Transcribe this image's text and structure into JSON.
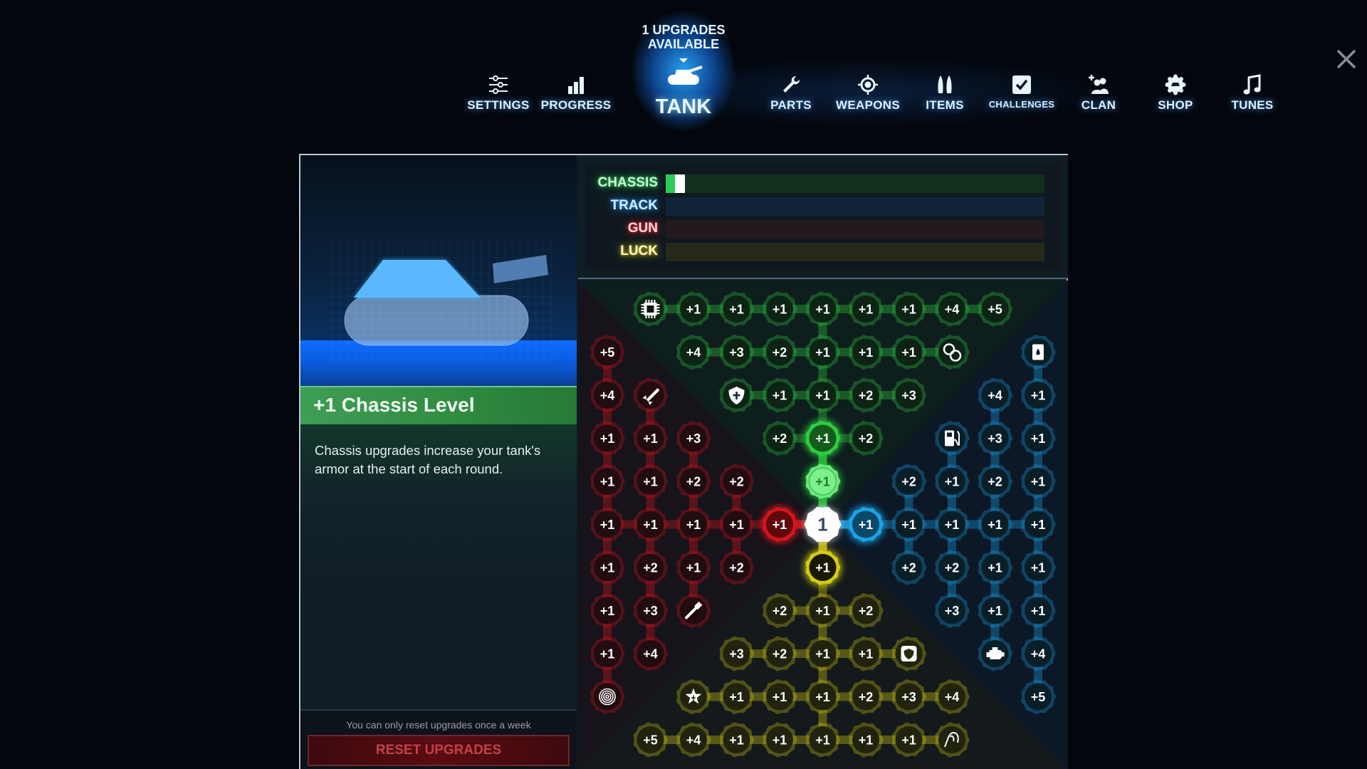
{
  "nav": {
    "items": [
      {
        "key": "settings",
        "label": "SETTINGS",
        "icon": "sliders-icon"
      },
      {
        "key": "progress",
        "label": "PROGRESS",
        "icon": "bar-chart-icon"
      },
      {
        "key": "parts",
        "label": "PARTS",
        "icon": "wrench-icon"
      },
      {
        "key": "weapons",
        "label": "WEAPONS",
        "icon": "crosshair-icon"
      },
      {
        "key": "items",
        "label": "ITEMS",
        "icon": "shells-icon"
      },
      {
        "key": "challenges",
        "label": "CHALLENGES",
        "icon": "checkbox-icon"
      },
      {
        "key": "clan",
        "label": "CLAN",
        "icon": "add-user-icon"
      },
      {
        "key": "shop",
        "label": "SHOP",
        "icon": "shop-badge-icon"
      },
      {
        "key": "tunes",
        "label": "TUNES",
        "icon": "music-note-icon"
      }
    ],
    "active": {
      "label": "TANK",
      "badge_line1": "1 UPGRADES",
      "badge_line2": "AVAILABLE",
      "icon": "tank-icon"
    },
    "close_icon": "close-icon"
  },
  "selected_upgrade": {
    "title": "+1 Chassis Level",
    "description": "Chassis upgrades increase your tank's armor at the start of each round."
  },
  "reset": {
    "note": "You can only reset upgrades once a week",
    "button_label": "RESET UPGRADES"
  },
  "stats": [
    {
      "label": "CHASSIS",
      "color": "#2ecc5a",
      "label_color": "#c9f5d4",
      "track_color": "#13301e",
      "level": 1,
      "pending": 1,
      "max": 40
    },
    {
      "label": "TRACK",
      "color": "#1e8ee6",
      "label_color": "#d4ecff",
      "track_color": "#10243a",
      "level": 0,
      "pending": 0,
      "max": 40
    },
    {
      "label": "GUN",
      "color": "#e0262e",
      "label_color": "#ffd6d8",
      "track_color": "#221a1e",
      "level": 0,
      "pending": 0,
      "max": 40
    },
    {
      "label": "LUCK",
      "color": "#c8c21a",
      "label_color": "#fff6c8",
      "track_color": "#262a1c",
      "level": 0,
      "pending": 0,
      "max": 40
    }
  ],
  "tree": {
    "center_label": "1",
    "colors": {
      "G": "#2ecc40",
      "R": "#d6141c",
      "B": "#1aa3e8",
      "Y": "#d4cc12"
    },
    "legend": "cells: type code | value ; G=chassis R=gun B=track Y=luck ; *=unlocked/next, #=purchased",
    "rows": [
      [
        "",
        "G|chip",
        "G|+1",
        "G|+1",
        "G|+1",
        "G|+1",
        "G|+1",
        "G|+1",
        "G|+4",
        "G|+5",
        ""
      ],
      [
        "R|+5",
        "",
        "G|+4",
        "G|+3",
        "G|+2",
        "G|+1",
        "G|+1",
        "G|+1",
        "G|gears",
        "",
        "B|barrel"
      ],
      [
        "R|+4",
        "R|missile",
        "",
        "G|shield",
        "G|+1",
        "G|+1",
        "G|+2",
        "G|+3",
        "",
        "B|+4",
        "B|+1"
      ],
      [
        "R|+1",
        "R|+1",
        "R|+3",
        "",
        "G|+2",
        "G*|+1",
        "G|+2",
        "",
        "B|fuel",
        "B|+3",
        "B|+1"
      ],
      [
        "R|+1",
        "R|+1",
        "R|+2",
        "R|+2",
        "",
        "G#|+1",
        "",
        "B|+2",
        "B|+1",
        "B|+2",
        "B|+1"
      ],
      [
        "R|+1",
        "R|+1",
        "R|+1",
        "R|+1",
        "R*|+1",
        "C|1",
        "B*|+1",
        "B|+1",
        "B|+1",
        "B|+1",
        "B|+1"
      ],
      [
        "R|+1",
        "R|+2",
        "R|+1",
        "R|+2",
        "",
        "Y*|+1",
        "",
        "B|+2",
        "B|+2",
        "B|+1",
        "B|+1"
      ],
      [
        "R|+1",
        "R|+3",
        "R|pen",
        "",
        "Y|+2",
        "Y|+1",
        "Y|+2",
        "",
        "B|+3",
        "B|+1",
        "B|+1"
      ],
      [
        "R|+1",
        "R|+4",
        "",
        "Y|+3",
        "Y|+2",
        "Y|+1",
        "Y|+1",
        "Y|armor",
        "",
        "B|engine",
        "B|+4"
      ],
      [
        "R|target",
        "",
        "Y|star",
        "Y|+1",
        "Y|+1",
        "Y|+1",
        "Y|+2",
        "Y|+3",
        "Y|+4",
        "",
        "B|+5"
      ],
      [
        "",
        "Y|+5",
        "Y|+4",
        "Y|+1",
        "Y|+1",
        "Y|+1",
        "Y|+1",
        "Y|+1",
        "Y|hook",
        "",
        ""
      ]
    ],
    "links": [
      [
        [
          0,
          1
        ],
        [
          0,
          2
        ]
      ],
      [
        [
          0,
          2
        ],
        [
          0,
          3
        ]
      ],
      [
        [
          0,
          3
        ],
        [
          0,
          4
        ]
      ],
      [
        [
          0,
          4
        ],
        [
          0,
          5
        ]
      ],
      [
        [
          0,
          5
        ],
        [
          0,
          6
        ]
      ],
      [
        [
          0,
          6
        ],
        [
          0,
          7
        ]
      ],
      [
        [
          0,
          7
        ],
        [
          0,
          8
        ]
      ],
      [
        [
          0,
          8
        ],
        [
          0,
          9
        ]
      ],
      [
        [
          0,
          5
        ],
        [
          1,
          5
        ]
      ],
      [
        [
          1,
          2
        ],
        [
          1,
          3
        ]
      ],
      [
        [
          1,
          3
        ],
        [
          1,
          4
        ]
      ],
      [
        [
          1,
          4
        ],
        [
          1,
          5
        ]
      ],
      [
        [
          1,
          5
        ],
        [
          1,
          6
        ]
      ],
      [
        [
          1,
          6
        ],
        [
          1,
          7
        ]
      ],
      [
        [
          1,
          7
        ],
        [
          1,
          8
        ]
      ],
      [
        [
          1,
          5
        ],
        [
          2,
          5
        ]
      ],
      [
        [
          2,
          3
        ],
        [
          2,
          4
        ]
      ],
      [
        [
          2,
          4
        ],
        [
          2,
          5
        ]
      ],
      [
        [
          2,
          5
        ],
        [
          2,
          6
        ]
      ],
      [
        [
          2,
          6
        ],
        [
          2,
          7
        ]
      ],
      [
        [
          2,
          5
        ],
        [
          3,
          5
        ]
      ],
      [
        [
          3,
          4
        ],
        [
          3,
          5
        ]
      ],
      [
        [
          3,
          5
        ],
        [
          3,
          6
        ]
      ],
      [
        [
          3,
          5
        ],
        [
          4,
          5
        ]
      ],
      [
        [
          4,
          5
        ],
        [
          5,
          5
        ]
      ],
      [
        [
          1,
          0
        ],
        [
          2,
          0
        ]
      ],
      [
        [
          2,
          0
        ],
        [
          3,
          0
        ]
      ],
      [
        [
          2,
          1
        ],
        [
          3,
          1
        ]
      ],
      [
        [
          3,
          0
        ],
        [
          4,
          0
        ]
      ],
      [
        [
          3,
          1
        ],
        [
          4,
          1
        ]
      ],
      [
        [
          3,
          2
        ],
        [
          4,
          2
        ]
      ],
      [
        [
          4,
          0
        ],
        [
          5,
          0
        ]
      ],
      [
        [
          4,
          1
        ],
        [
          5,
          1
        ]
      ],
      [
        [
          4,
          2
        ],
        [
          5,
          2
        ]
      ],
      [
        [
          4,
          3
        ],
        [
          5,
          3
        ]
      ],
      [
        [
          5,
          0
        ],
        [
          5,
          1
        ]
      ],
      [
        [
          5,
          1
        ],
        [
          5,
          2
        ]
      ],
      [
        [
          5,
          2
        ],
        [
          5,
          3
        ]
      ],
      [
        [
          5,
          3
        ],
        [
          5,
          4
        ]
      ],
      [
        [
          5,
          4
        ],
        [
          5,
          5
        ]
      ],
      [
        [
          5,
          0
        ],
        [
          6,
          0
        ]
      ],
      [
        [
          5,
          1
        ],
        [
          6,
          1
        ]
      ],
      [
        [
          5,
          2
        ],
        [
          6,
          2
        ]
      ],
      [
        [
          5,
          3
        ],
        [
          6,
          3
        ]
      ],
      [
        [
          6,
          0
        ],
        [
          7,
          0
        ]
      ],
      [
        [
          6,
          1
        ],
        [
          7,
          1
        ]
      ],
      [
        [
          6,
          2
        ],
        [
          7,
          2
        ]
      ],
      [
        [
          7,
          0
        ],
        [
          8,
          0
        ]
      ],
      [
        [
          7,
          1
        ],
        [
          8,
          1
        ]
      ],
      [
        [
          8,
          0
        ],
        [
          9,
          0
        ]
      ],
      [
        [
          5,
          5
        ],
        [
          5,
          6
        ]
      ],
      [
        [
          5,
          6
        ],
        [
          5,
          7
        ]
      ],
      [
        [
          5,
          7
        ],
        [
          5,
          8
        ]
      ],
      [
        [
          5,
          8
        ],
        [
          5,
          9
        ]
      ],
      [
        [
          5,
          9
        ],
        [
          5,
          10
        ]
      ],
      [
        [
          4,
          7
        ],
        [
          5,
          7
        ]
      ],
      [
        [
          4,
          8
        ],
        [
          5,
          8
        ]
      ],
      [
        [
          4,
          9
        ],
        [
          5,
          9
        ]
      ],
      [
        [
          4,
          10
        ],
        [
          5,
          10
        ]
      ],
      [
        [
          3,
          8
        ],
        [
          4,
          8
        ]
      ],
      [
        [
          3,
          9
        ],
        [
          4,
          9
        ]
      ],
      [
        [
          3,
          10
        ],
        [
          4,
          10
        ]
      ],
      [
        [
          2,
          9
        ],
        [
          3,
          9
        ]
      ],
      [
        [
          2,
          10
        ],
        [
          3,
          10
        ]
      ],
      [
        [
          1,
          10
        ],
        [
          2,
          10
        ]
      ],
      [
        [
          5,
          7
        ],
        [
          6,
          7
        ]
      ],
      [
        [
          5,
          8
        ],
        [
          6,
          8
        ]
      ],
      [
        [
          5,
          9
        ],
        [
          6,
          9
        ]
      ],
      [
        [
          5,
          10
        ],
        [
          6,
          10
        ]
      ],
      [
        [
          6,
          8
        ],
        [
          7,
          8
        ]
      ],
      [
        [
          6,
          9
        ],
        [
          7,
          9
        ]
      ],
      [
        [
          6,
          10
        ],
        [
          7,
          10
        ]
      ],
      [
        [
          7,
          9
        ],
        [
          8,
          9
        ]
      ],
      [
        [
          7,
          10
        ],
        [
          8,
          10
        ]
      ],
      [
        [
          8,
          10
        ],
        [
          9,
          10
        ]
      ],
      [
        [
          5,
          5
        ],
        [
          6,
          5
        ]
      ],
      [
        [
          6,
          5
        ],
        [
          7,
          5
        ]
      ],
      [
        [
          7,
          4
        ],
        [
          7,
          5
        ]
      ],
      [
        [
          7,
          5
        ],
        [
          7,
          6
        ]
      ],
      [
        [
          7,
          5
        ],
        [
          8,
          5
        ]
      ],
      [
        [
          8,
          3
        ],
        [
          8,
          4
        ]
      ],
      [
        [
          8,
          4
        ],
        [
          8,
          5
        ]
      ],
      [
        [
          8,
          5
        ],
        [
          8,
          6
        ]
      ],
      [
        [
          8,
          6
        ],
        [
          8,
          7
        ]
      ],
      [
        [
          8,
          5
        ],
        [
          9,
          5
        ]
      ],
      [
        [
          9,
          2
        ],
        [
          9,
          3
        ]
      ],
      [
        [
          9,
          3
        ],
        [
          9,
          4
        ]
      ],
      [
        [
          9,
          4
        ],
        [
          9,
          5
        ]
      ],
      [
        [
          9,
          5
        ],
        [
          9,
          6
        ]
      ],
      [
        [
          9,
          6
        ],
        [
          9,
          7
        ]
      ],
      [
        [
          9,
          7
        ],
        [
          9,
          8
        ]
      ],
      [
        [
          9,
          5
        ],
        [
          10,
          5
        ]
      ],
      [
        [
          10,
          1
        ],
        [
          10,
          2
        ]
      ],
      [
        [
          10,
          2
        ],
        [
          10,
          3
        ]
      ],
      [
        [
          10,
          3
        ],
        [
          10,
          4
        ]
      ],
      [
        [
          10,
          4
        ],
        [
          10,
          5
        ]
      ],
      [
        [
          10,
          5
        ],
        [
          10,
          6
        ]
      ],
      [
        [
          10,
          6
        ],
        [
          10,
          7
        ]
      ],
      [
        [
          10,
          7
        ],
        [
          10,
          8
        ]
      ]
    ]
  }
}
